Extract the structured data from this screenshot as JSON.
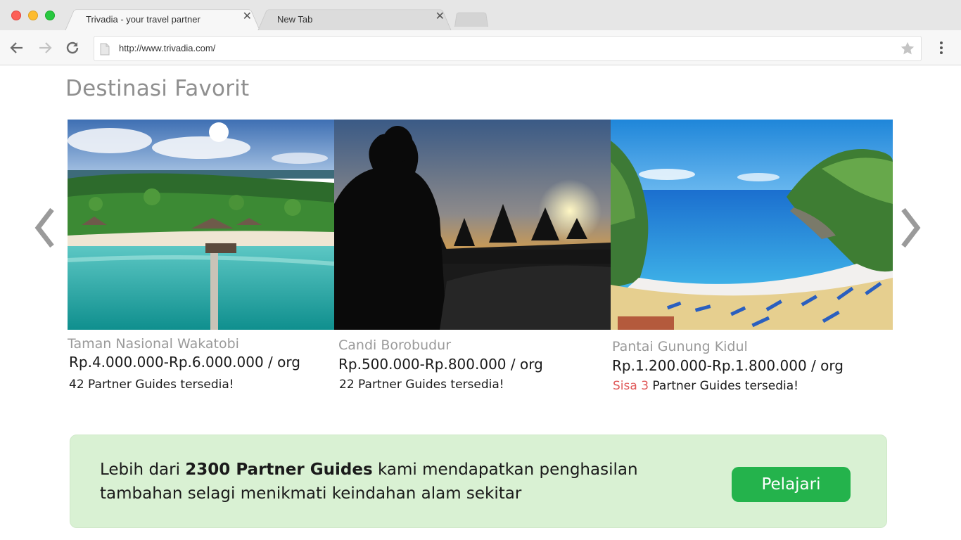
{
  "browser": {
    "tabs": [
      {
        "title": "Trivadia - your travel partner",
        "active": true
      },
      {
        "title": "New Tab",
        "active": false
      }
    ],
    "close_glyph": "✕",
    "url": "http://www.trivadia.com/"
  },
  "page": {
    "title": "Destinasi Favorit",
    "destinations": [
      {
        "name": "Taman Nasional Wakatobi",
        "price": "Rp.4.000.000-Rp.6.000.000 / org",
        "guides": "42 Partner Guides tersedia!",
        "guides_alert": ""
      },
      {
        "name": "Candi Borobudur",
        "price": "Rp.500.000-Rp.800.000 / org",
        "guides": "22 Partner Guides tersedia!",
        "guides_alert": ""
      },
      {
        "name": "Pantai Gunung Kidul",
        "price": "Rp.1.200.000-Rp.1.800.000 / org",
        "guides": "Partner Guides tersedia!",
        "guides_alert": "Sisa 3"
      }
    ],
    "banner": {
      "prefix": "Lebih dari",
      "highlight": "2300 Partner Guides",
      "suffix": "kami mendapatkan penghasilan tambahan selagi menikmati keindahan alam sekitar",
      "button_label": "Pelajari"
    }
  },
  "colors": {
    "banner_bg": "#d9f1d3",
    "button_green": "#24b34c",
    "alert_red": "#e05a5a",
    "title_gray": "#8f8f8f"
  },
  "icons": [
    "back-arrow-icon",
    "forward-arrow-icon",
    "reload-icon",
    "page-icon",
    "star-icon",
    "menu-dots-icon",
    "chevron-left-icon",
    "chevron-right-icon"
  ]
}
